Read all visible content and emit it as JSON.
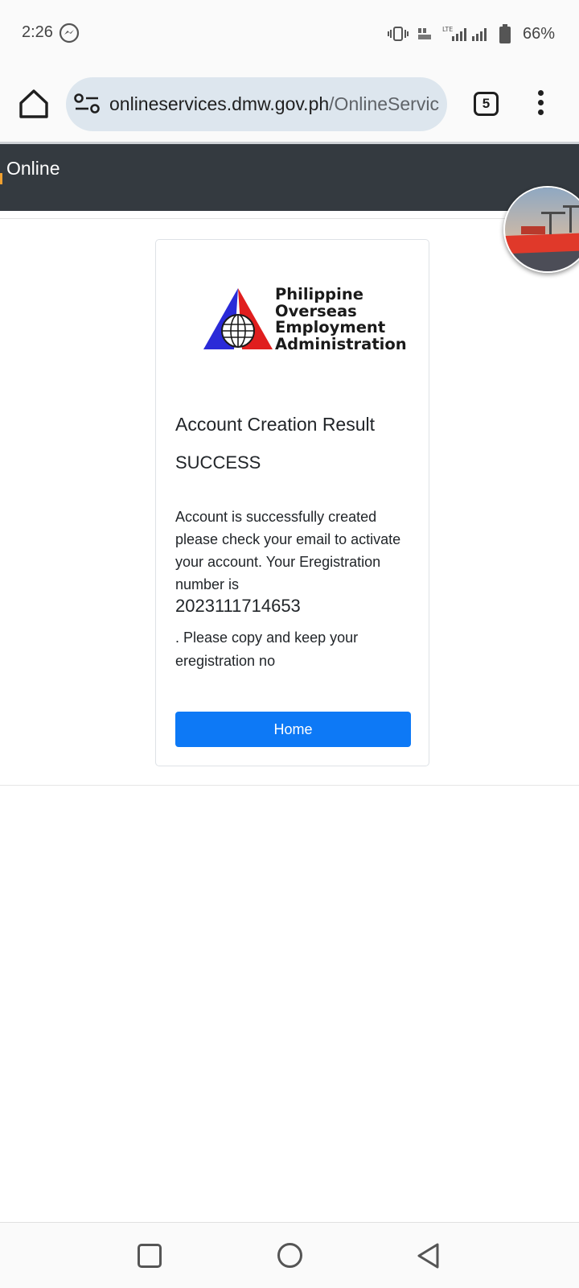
{
  "status_bar": {
    "time": "2:26",
    "battery": "66%",
    "network": "LTE",
    "icons": [
      "messenger-icon",
      "vibrate-icon",
      "volte-icon",
      "signal-icon",
      "battery-icon"
    ]
  },
  "browser": {
    "url_host": "onlineservices.dmw.gov.ph",
    "url_path": "/OnlineServic",
    "tab_count": "5",
    "icons": [
      "home-icon",
      "site-settings-icon",
      "tabs-icon",
      "more-vert-icon"
    ]
  },
  "site": {
    "header_title": "Online"
  },
  "card": {
    "logo_lines": [
      "Philippine",
      "Overseas",
      "Employment",
      "Administration"
    ],
    "title": "Account Creation Result",
    "status": "SUCCESS",
    "message": "Account is successfully created please check your email to activate your account. Your Eregistration number is",
    "registration_number": "2023111714653",
    "message_after": ". Please copy and keep your eregistration no",
    "home_button": "Home"
  },
  "colors": {
    "header_bg": "#343a40",
    "button_bg": "#0d79f6",
    "url_pill_bg": "#dde6ee",
    "logo_blue": "#2a2ad8",
    "logo_red": "#e01e1e"
  },
  "nav_bar": {
    "icons": [
      "recents-icon",
      "home-circle-icon",
      "back-icon"
    ]
  }
}
